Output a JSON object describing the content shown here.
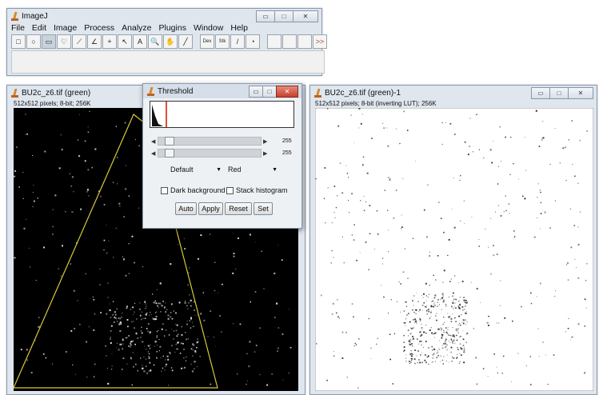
{
  "imagej": {
    "title": "ImageJ",
    "menu": [
      "File",
      "Edit",
      "Image",
      "Process",
      "Analyze",
      "Plugins",
      "Window",
      "Help"
    ],
    "tools": [
      {
        "name": "rectangle-tool-icon",
        "glyph": "□"
      },
      {
        "name": "oval-tool-icon",
        "glyph": "○"
      },
      {
        "name": "polygon-tool-icon",
        "glyph": "▭"
      },
      {
        "name": "freehand-tool-icon",
        "glyph": "♡"
      },
      {
        "name": "line-tool-icon",
        "glyph": "⟋"
      },
      {
        "name": "angle-tool-icon",
        "glyph": "∠"
      },
      {
        "name": "point-tool-icon",
        "glyph": "+"
      },
      {
        "name": "wand-tool-icon",
        "glyph": "↖"
      },
      {
        "name": "text-tool-icon",
        "glyph": "A"
      },
      {
        "name": "magnifier-tool-icon",
        "glyph": "🔍"
      },
      {
        "name": "hand-tool-icon",
        "glyph": "✋"
      },
      {
        "name": "dropper-tool-icon",
        "glyph": "╱"
      },
      {
        "name": "dev-tool-icon",
        "glyph": "Dev"
      },
      {
        "name": "stk-tool-icon",
        "glyph": "Stk"
      },
      {
        "name": "brush-tool-icon",
        "glyph": "/"
      },
      {
        "name": "flood-fill-tool-icon",
        "glyph": "◔"
      },
      {
        "name": "more-tools-icon",
        "glyph": ">>"
      }
    ]
  },
  "left_image": {
    "title": "BU2c_z6.tif (green)",
    "info": "512x512 pixels; 8-bit; 256K"
  },
  "threshold": {
    "title": "Threshold",
    "slider1_value": "255",
    "slider2_value": "255",
    "method": "Default",
    "display": "Red",
    "dark_background": "Dark background",
    "stack_histogram": "Stack histogram",
    "buttons": [
      "Auto",
      "Apply",
      "Reset",
      "Set"
    ]
  },
  "right_image": {
    "title": "BU2c_z6.tif (green)-1",
    "info": "512x512 pixels; 8-bit (inverting LUT); 256K"
  },
  "colors": {
    "titlebar": "#dfe6ee",
    "close_red": "#c6402c",
    "threshold_marker": "#e05030",
    "roi_yellow": "#d8c83a"
  }
}
